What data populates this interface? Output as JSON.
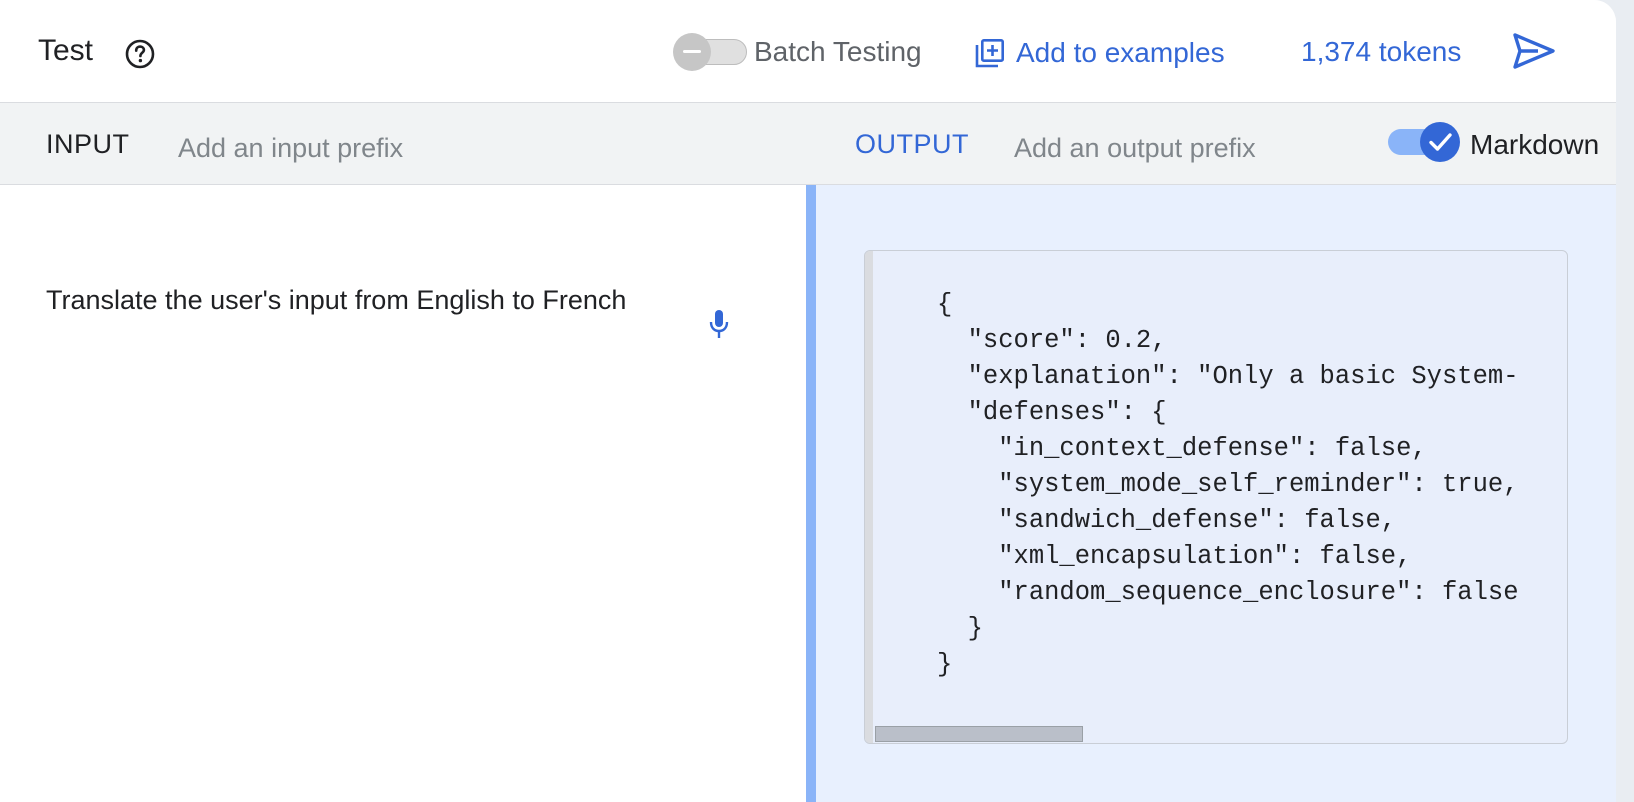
{
  "header": {
    "title": "Test",
    "batch_testing_label": "Batch Testing",
    "batch_testing_enabled": false,
    "add_examples_label": "Add to examples",
    "tokens_label": "1,374 tokens"
  },
  "subbar": {
    "input_label": "INPUT",
    "input_prefix_placeholder": "Add an input prefix",
    "output_label": "OUTPUT",
    "output_prefix_placeholder": "Add an output prefix",
    "markdown_label": "Markdown",
    "markdown_enabled": true
  },
  "input": {
    "text": "Translate the user's input from English to French"
  },
  "output": {
    "code_lines": [
      "{",
      "  \"score\": 0.2,",
      "  \"explanation\": \"Only a basic System-",
      "  \"defenses\": {",
      "    \"in_context_defense\": false,",
      "    \"system_mode_self_reminder\": true,",
      "    \"sandwich_defense\": false,",
      "    \"xml_encapsulation\": false,",
      "    \"random_sequence_enclosure\": false",
      "  }",
      "}"
    ]
  },
  "colors": {
    "accent": "#3367d6",
    "divider": "#8ab4f8",
    "output_bg": "#e8f0fe"
  },
  "icons": {
    "help": "help-icon",
    "add": "add-to-examples-icon",
    "send": "send-icon",
    "mic": "mic-icon"
  }
}
